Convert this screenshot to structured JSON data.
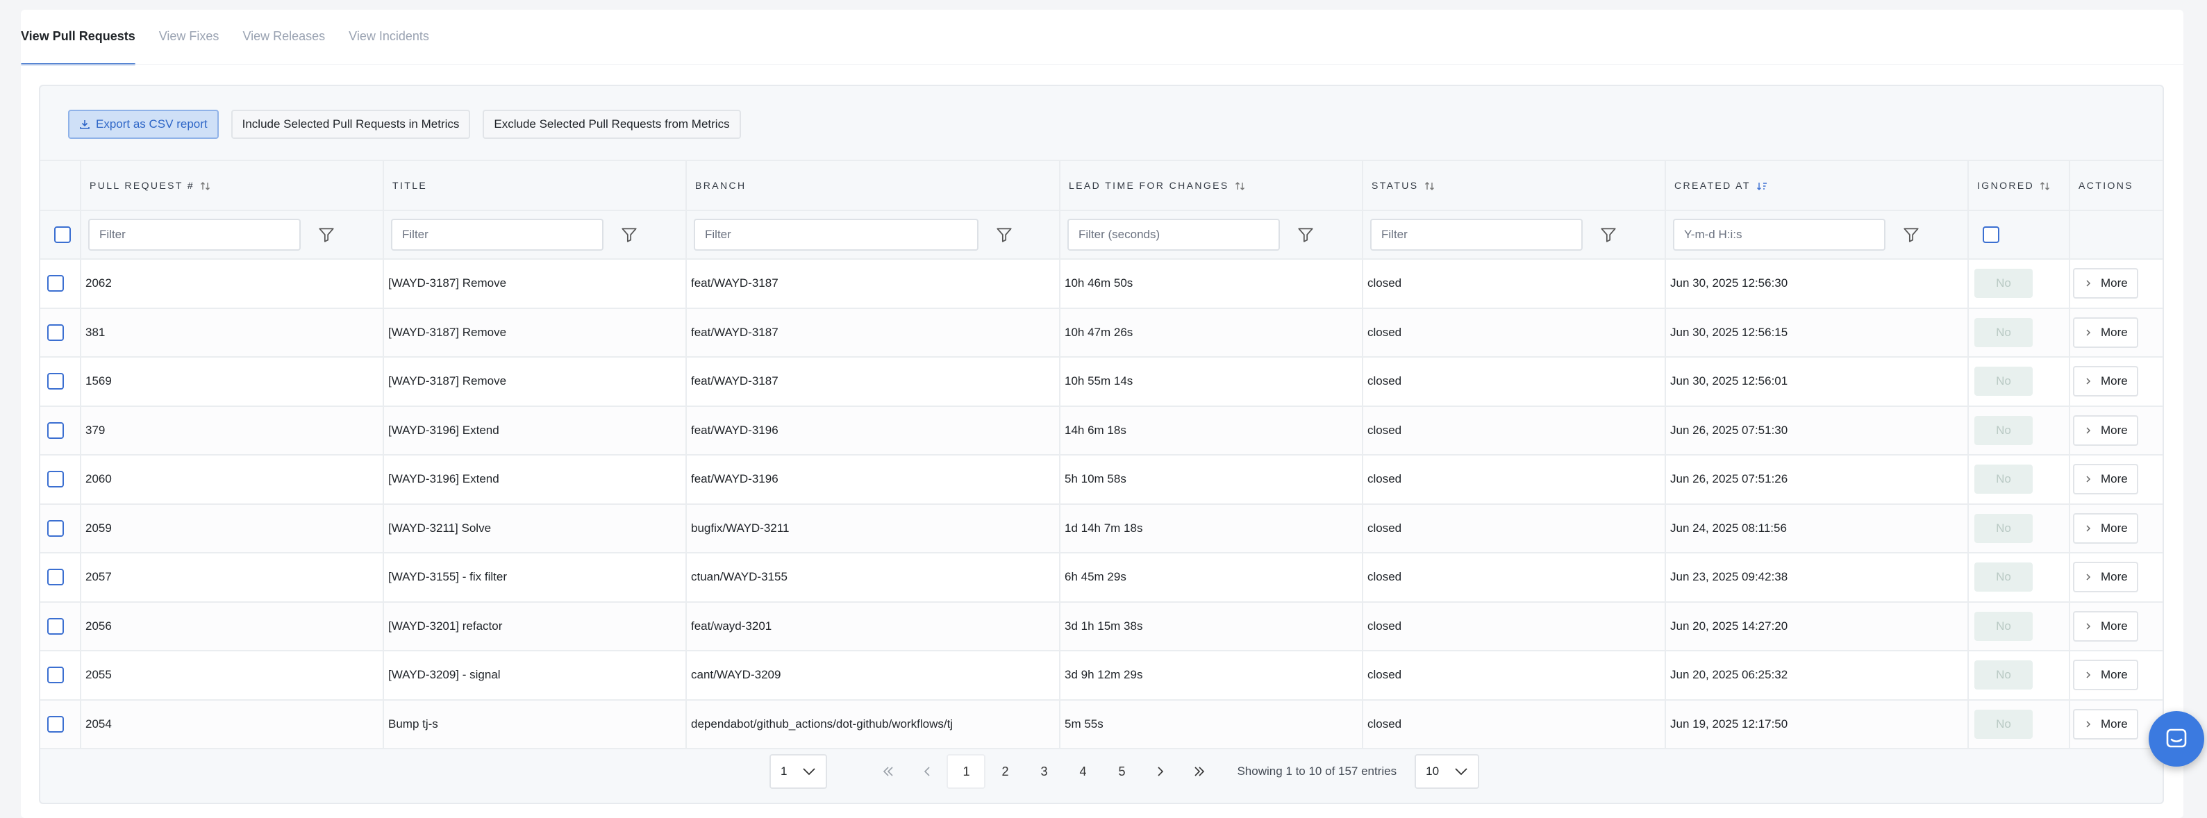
{
  "tabs": [
    {
      "label": "View Pull Requests",
      "active": true
    },
    {
      "label": "View Fixes",
      "active": false
    },
    {
      "label": "View Releases",
      "active": false
    },
    {
      "label": "View Incidents",
      "active": false
    }
  ],
  "toolbar": {
    "export_label": "Export as CSV report",
    "include_label": "Include Selected Pull Requests in Metrics",
    "exclude_label": "Exclude Selected Pull Requests from Metrics"
  },
  "columns": {
    "pr_number": "PULL REQUEST #",
    "title": "TITLE",
    "branch": "BRANCH",
    "lead_time": "LEAD TIME FOR CHANGES",
    "status": "STATUS",
    "created_at": "CREATED AT",
    "ignored": "IGNORED",
    "actions": "ACTIONS"
  },
  "filters": {
    "pr_number": "Filter",
    "title": "Filter",
    "branch": "Filter",
    "lead_time": "Filter (seconds)",
    "status": "Filter",
    "created_at": "Y-m-d H:i:s"
  },
  "rows": [
    {
      "pr": "2062",
      "title": "[WAYD-3187] Remove",
      "branch": "feat/WAYD-3187",
      "lead": "10h 46m 50s",
      "status": "closed",
      "created": "Jun 30, 2025 12:56:30",
      "ignored": "No",
      "action": "More"
    },
    {
      "pr": "381",
      "title": "[WAYD-3187] Remove",
      "branch": "feat/WAYD-3187",
      "lead": "10h 47m 26s",
      "status": "closed",
      "created": "Jun 30, 2025 12:56:15",
      "ignored": "No",
      "action": "More"
    },
    {
      "pr": "1569",
      "title": "[WAYD-3187] Remove",
      "branch": "feat/WAYD-3187",
      "lead": "10h 55m 14s",
      "status": "closed",
      "created": "Jun 30, 2025 12:56:01",
      "ignored": "No",
      "action": "More"
    },
    {
      "pr": "379",
      "title": "[WAYD-3196] Extend",
      "branch": "feat/WAYD-3196",
      "lead": "14h 6m 18s",
      "status": "closed",
      "created": "Jun 26, 2025 07:51:30",
      "ignored": "No",
      "action": "More"
    },
    {
      "pr": "2060",
      "title": "[WAYD-3196] Extend",
      "branch": "feat/WAYD-3196",
      "lead": "5h 10m 58s",
      "status": "closed",
      "created": "Jun 26, 2025 07:51:26",
      "ignored": "No",
      "action": "More"
    },
    {
      "pr": "2059",
      "title": "[WAYD-3211] Solve",
      "branch": "bugfix/WAYD-3211",
      "lead": "1d 14h 7m 18s",
      "status": "closed",
      "created": "Jun 24, 2025 08:11:56",
      "ignored": "No",
      "action": "More"
    },
    {
      "pr": "2057",
      "title": "[WAYD-3155] - fix filter",
      "branch": "ctuan/WAYD-3155",
      "lead": "6h 45m 29s",
      "status": "closed",
      "created": "Jun 23, 2025 09:42:38",
      "ignored": "No",
      "action": "More"
    },
    {
      "pr": "2056",
      "title": "[WAYD-3201] refactor",
      "branch": "feat/wayd-3201",
      "lead": "3d 1h 15m 38s",
      "status": "closed",
      "created": "Jun 20, 2025 14:27:20",
      "ignored": "No",
      "action": "More"
    },
    {
      "pr": "2055",
      "title": "[WAYD-3209] - signal",
      "branch": "cant/WAYD-3209",
      "lead": "3d 9h 12m 29s",
      "status": "closed",
      "created": "Jun 20, 2025 06:25:32",
      "ignored": "No",
      "action": "More"
    },
    {
      "pr": "2054",
      "title": "Bump tj-s",
      "branch": "dependabot/github_actions/dot-github/workflows/tj",
      "lead": "5m 55s",
      "status": "closed",
      "created": "Jun 19, 2025 12:17:50",
      "ignored": "No",
      "action": "More"
    }
  ],
  "pagination": {
    "page_select": "1",
    "pages": [
      "1",
      "2",
      "3",
      "4",
      "5"
    ],
    "current": "1",
    "info": "Showing 1 to 10 of 157 entries",
    "page_size": "10"
  },
  "colors": {
    "accent": "#3b6fd1",
    "export_bg": "#cfe0f7",
    "badge_bg": "#e8f0ee",
    "fab": "#3b7ae0"
  }
}
